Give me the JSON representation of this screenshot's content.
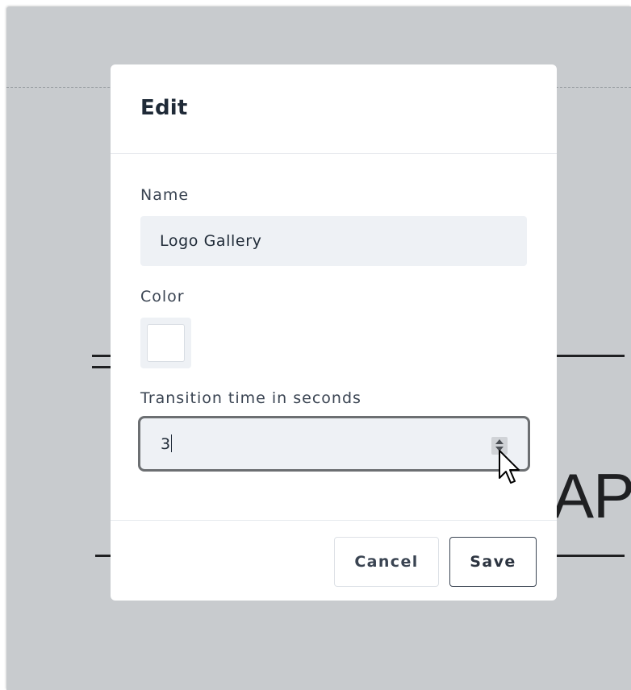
{
  "modal": {
    "title": "Edit",
    "fields": {
      "name": {
        "label": "Name",
        "value": "Logo Gallery"
      },
      "color": {
        "label": "Color",
        "value": "#ffffff"
      },
      "transition": {
        "label": "Transition time in seconds",
        "value": "3"
      }
    },
    "buttons": {
      "cancel": "Cancel",
      "save": "Save"
    }
  },
  "background": {
    "text_fragment": "AP"
  },
  "colors": {
    "backdrop": "#c8cbce",
    "input_bg": "#eef1f5",
    "text": "#1f2a37",
    "focus_border": "#6c6f72"
  },
  "icons": [
    "number-spinner-icon",
    "mouse-pointer-icon"
  ]
}
